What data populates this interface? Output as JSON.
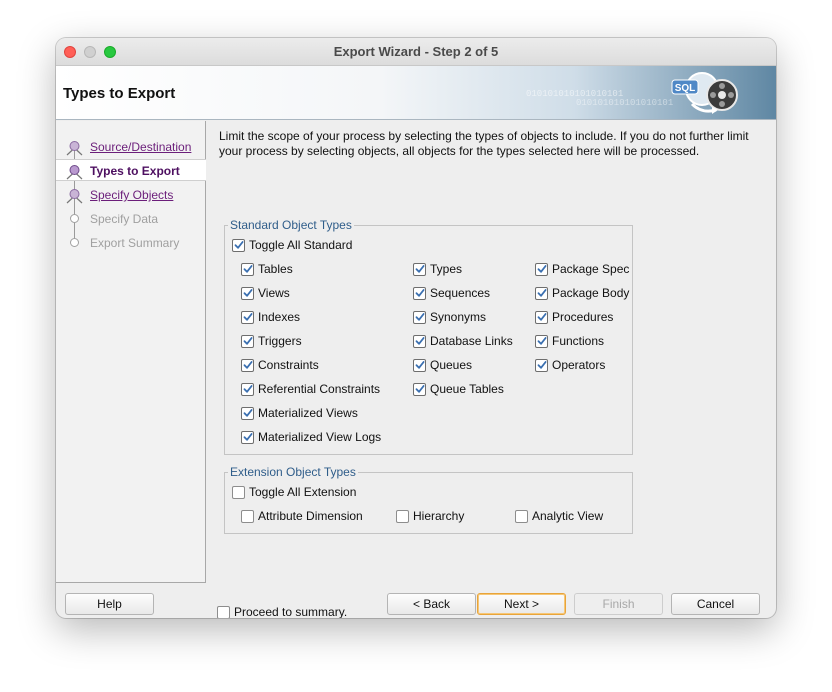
{
  "window": {
    "title": "Export Wizard - Step 2 of 5"
  },
  "banner": {
    "title": "Types to Export",
    "art_binary": "010101010101010101",
    "art_label": "SQL"
  },
  "nav": {
    "items": [
      {
        "label": "Source/Destination",
        "state": "link"
      },
      {
        "label": "Types to Export",
        "state": "current"
      },
      {
        "label": "Specify Objects",
        "state": "link"
      },
      {
        "label": "Specify Data",
        "state": "disabled"
      },
      {
        "label": "Export Summary",
        "state": "disabled"
      }
    ]
  },
  "description": "Limit the scope of your process by selecting the types of objects to include.  If you do not further limit your process by selecting objects, all objects for the types selected here will be processed.",
  "standard": {
    "legend": "Standard Object Types",
    "toggle": {
      "label": "Toggle All Standard",
      "checked": true
    },
    "items": [
      {
        "label": "Tables",
        "checked": true
      },
      {
        "label": "Views",
        "checked": true
      },
      {
        "label": "Indexes",
        "checked": true
      },
      {
        "label": "Triggers",
        "checked": true
      },
      {
        "label": "Constraints",
        "checked": true
      },
      {
        "label": "Referential Constraints",
        "checked": true
      },
      {
        "label": "Materialized Views",
        "checked": true
      },
      {
        "label": "Materialized View Logs",
        "checked": true
      },
      {
        "label": "Types",
        "checked": true
      },
      {
        "label": "Sequences",
        "checked": true
      },
      {
        "label": "Synonyms",
        "checked": true
      },
      {
        "label": "Database Links",
        "checked": true
      },
      {
        "label": "Queues",
        "checked": true
      },
      {
        "label": "Queue Tables",
        "checked": true
      },
      {
        "label": "Package Spec",
        "checked": true
      },
      {
        "label": "Package Body",
        "checked": true
      },
      {
        "label": "Procedures",
        "checked": true
      },
      {
        "label": "Functions",
        "checked": true
      },
      {
        "label": "Operators",
        "checked": true
      }
    ]
  },
  "extension": {
    "legend": "Extension Object Types",
    "toggle": {
      "label": "Toggle All Extension",
      "checked": false
    },
    "items": [
      {
        "label": "Attribute Dimension",
        "checked": false
      },
      {
        "label": "Hierarchy",
        "checked": false
      },
      {
        "label": "Analytic View",
        "checked": false
      }
    ]
  },
  "proceed": {
    "label": "Proceed to summary.",
    "checked": false
  },
  "buttons": {
    "help": "Help",
    "back": "< Back",
    "next": "Next >",
    "finish": "Finish",
    "cancel": "Cancel"
  },
  "colors": {
    "nav_link": "#6b1e7a",
    "legend": "#2f5d8a",
    "default_button_border": "#e8a43a"
  }
}
